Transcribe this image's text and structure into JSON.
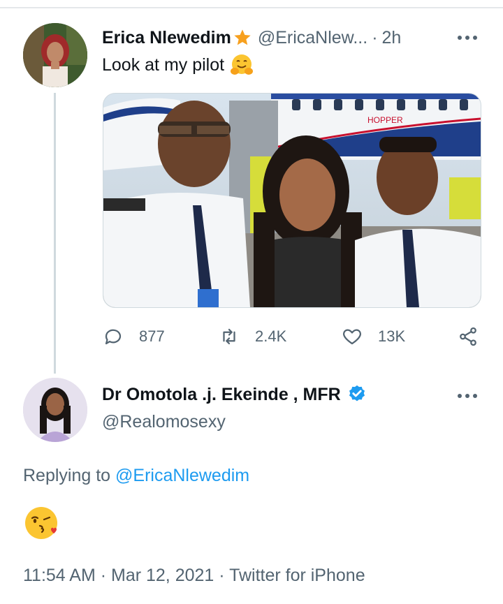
{
  "tweet": {
    "author_name": "Erica Nlewedim",
    "author_handle": "@EricaNlew...",
    "separator": "·",
    "time_ago": "2h",
    "text": "Look at my pilot",
    "stats": {
      "replies": "877",
      "retweets": "2.4K",
      "likes": "13K"
    },
    "media_text": "HOPPER"
  },
  "reply": {
    "author_name": "Dr Omotola .j. Ekeinde , MFR",
    "author_handle": "@Realomosexy",
    "replying_prefix": "Replying to ",
    "replying_to": "@EricaNlewedim",
    "timestamp": "11:54 AM · Mar 12, 2021 · Twitter for iPhone"
  },
  "icons": {
    "star": "star-icon",
    "hug": "hugging-face-icon",
    "verified": "verified-badge-icon",
    "more": "more-options-icon",
    "reply": "reply-icon",
    "retweet": "retweet-icon",
    "like": "heart-icon",
    "share": "share-icon",
    "kiss": "face-blowing-kiss-icon"
  },
  "colors": {
    "accent": "#1d9bf0",
    "secondary_text": "#536471",
    "primary_text": "#0f1419",
    "thread_line": "#cfd9de",
    "star": "#f7a01e"
  }
}
